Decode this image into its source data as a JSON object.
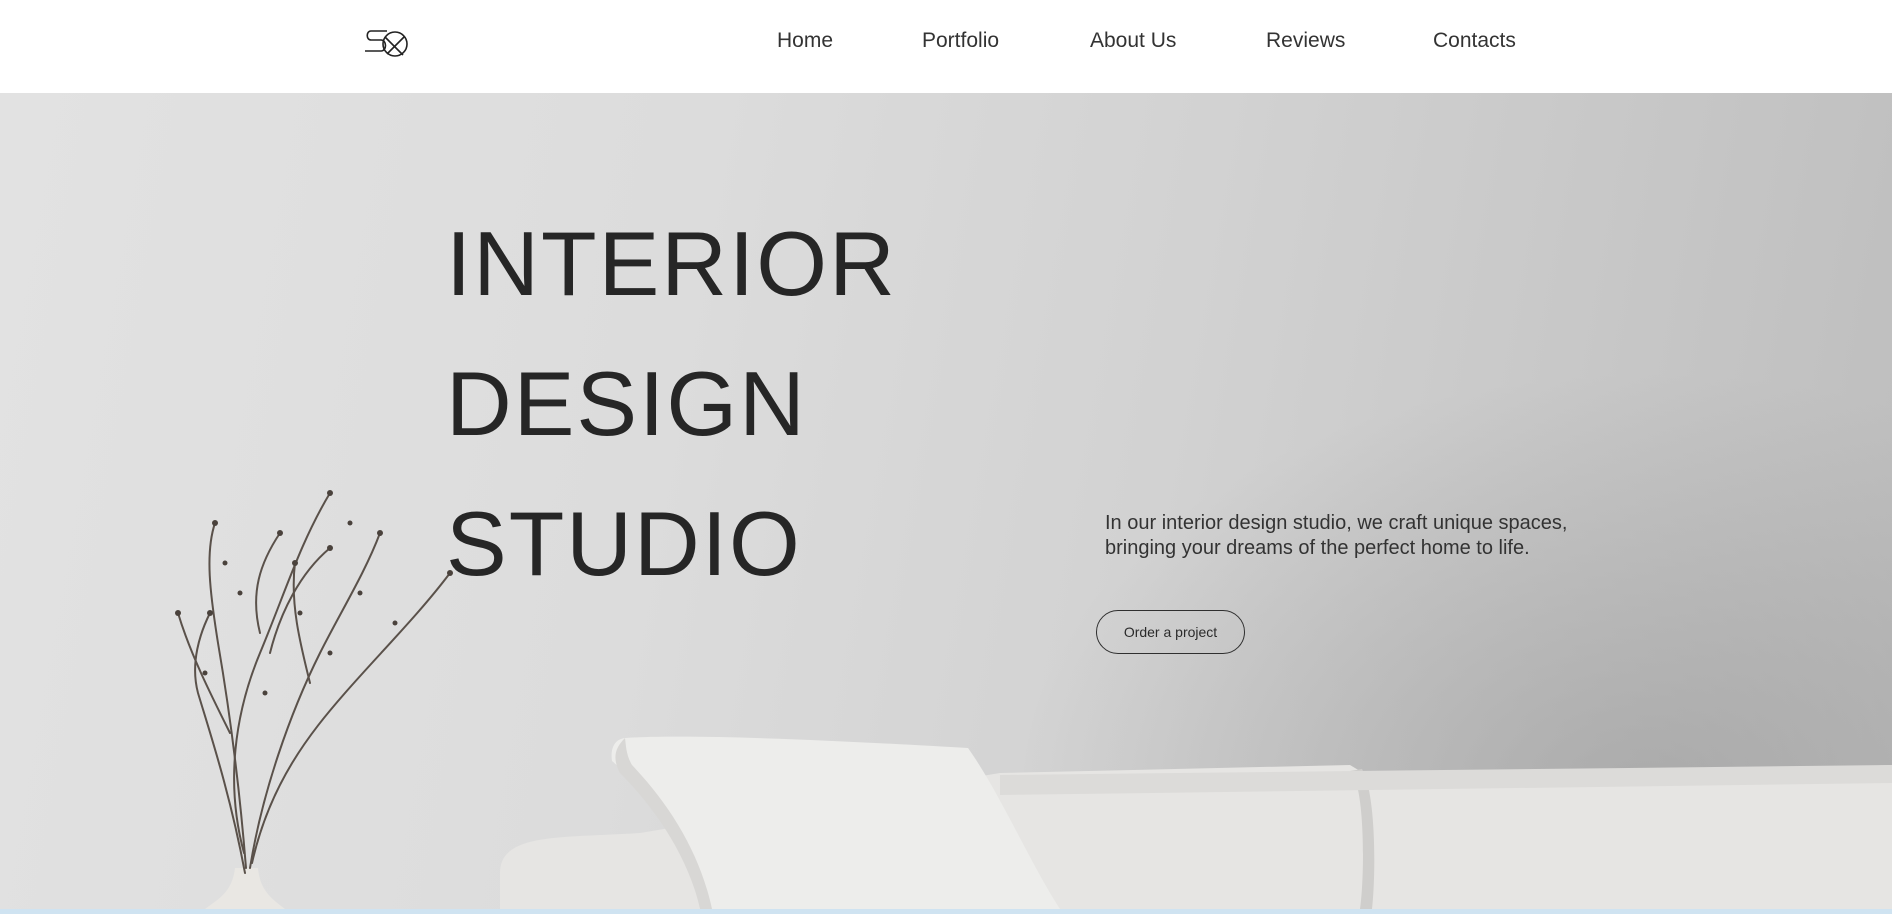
{
  "nav": {
    "items": [
      {
        "label": "Home"
      },
      {
        "label": "Portfolio"
      },
      {
        "label": "About Us"
      },
      {
        "label": "Reviews"
      },
      {
        "label": "Contacts"
      }
    ]
  },
  "hero": {
    "title_lines": [
      "INTERIOR",
      "DESIGN",
      "STUDIO"
    ],
    "tagline": "In our interior design studio, we craft unique spaces, bringing your dreams of the perfect home to life.",
    "cta_label": "Order a project"
  },
  "icons": {
    "logo": "studio-logo-icon"
  },
  "colors": {
    "text": "#262626",
    "background": "#ffffff",
    "hero_wall": "#dcdcdc",
    "accent_strip": "#cfe3f1"
  }
}
